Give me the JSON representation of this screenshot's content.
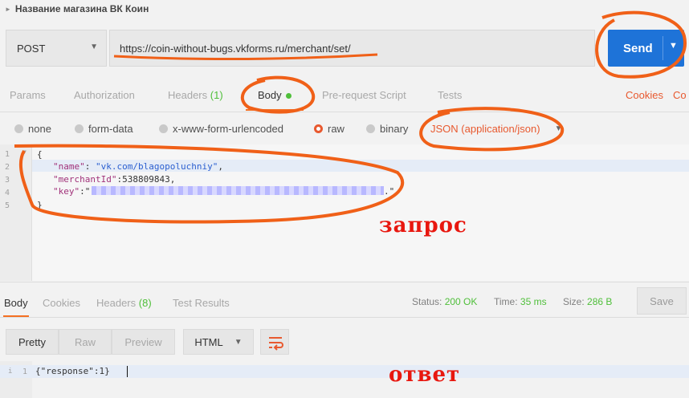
{
  "window": {
    "title": "Название магазина ВК Коин"
  },
  "request": {
    "method": "POST",
    "url": "https://coin-without-bugs.vkforms.ru/merchant/set/",
    "send_label": "Send",
    "tabs": [
      {
        "label": "Params"
      },
      {
        "label": "Authorization"
      },
      {
        "label": "Headers",
        "count": "(1)"
      },
      {
        "label": "Body"
      },
      {
        "label": "Pre-request Script"
      },
      {
        "label": "Tests"
      }
    ],
    "links": {
      "cookies": "Cookies",
      "code": "Co"
    },
    "body_types": [
      "none",
      "form-data",
      "x-www-form-urlencoded",
      "raw",
      "binary"
    ],
    "selected_body_type": "raw",
    "content_type": "JSON (application/json)",
    "editor": {
      "line_numbers": [
        "1",
        "2",
        "3",
        "4",
        "5"
      ],
      "open_brace": "{",
      "line2": {
        "key": "\"name\"",
        "colon": ": ",
        "value": "\"vk.com/blagopoluchniy\"",
        "comma": ","
      },
      "line3": {
        "key": "\"merchantId\"",
        "value": ":538809843,"
      },
      "line4": {
        "key": "\"key\"",
        "prefix": ":\"",
        "suffix": ".\""
      },
      "close_brace": "}"
    },
    "annotation": "запрос"
  },
  "response": {
    "tabs": [
      {
        "label": "Body"
      },
      {
        "label": "Cookies"
      },
      {
        "label": "Headers",
        "count": "(8)"
      },
      {
        "label": "Test Results"
      }
    ],
    "status_label": "Status:",
    "status_value": "200 OK",
    "time_label": "Time:",
    "time_value": "35 ms",
    "size_label": "Size:",
    "size_value": "286 B",
    "save_label": "Save",
    "view_modes": [
      "Pretty",
      "Raw",
      "Preview"
    ],
    "format": "HTML",
    "line_number": "1",
    "body": "{\"response\":1}",
    "annotation": "ответ"
  },
  "colors": {
    "accent": "#f47023",
    "send": "#1e73d8",
    "annotation": "#e8170f",
    "count": "#4fbf3a"
  }
}
